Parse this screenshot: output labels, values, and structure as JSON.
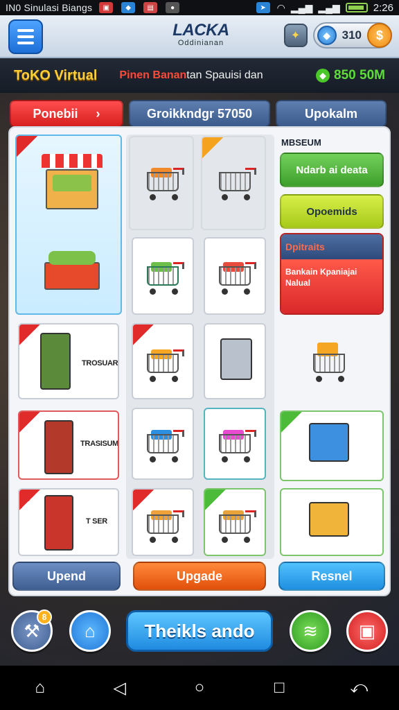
{
  "status_bar": {
    "app_name": "IN0 Sinulasi Biangs",
    "time": "2:26"
  },
  "header": {
    "logo_main": "LACKA",
    "logo_sub": "Oddinianan",
    "gems": "310",
    "coin_symbol": "$"
  },
  "title_strip": {
    "game_title": "ToKO Virtual",
    "promo_highlight": "Pinen Banan",
    "promo_rest": "tan Spauisi dan",
    "balance": "850 50M"
  },
  "tabs": [
    {
      "label": "Ponebii"
    },
    {
      "label": "Groikkndgr   57050"
    },
    {
      "label": "Upokalm"
    }
  ],
  "grid": {
    "tile_labels": [
      "TROSUAR",
      "TRASISUM",
      "T SER"
    ]
  },
  "sidebar": {
    "section_label": "MBSEUM",
    "button_1": "Ndarb ai deata",
    "button_2": "Opoemids",
    "info_title": "Dpitraits",
    "info_text": "Bankain Kpaniajai Nalual"
  },
  "actions": {
    "left": "Upend",
    "center": "Upgade",
    "right": "Resnel"
  },
  "game_nav": {
    "badge_count": "8",
    "center_label": "Theikls ando"
  },
  "colors": {
    "accent_red": "#d71f1f",
    "accent_blue": "#1f8be0",
    "accent_green": "#3d9f2b",
    "title_gold": "#ffcf3a"
  }
}
